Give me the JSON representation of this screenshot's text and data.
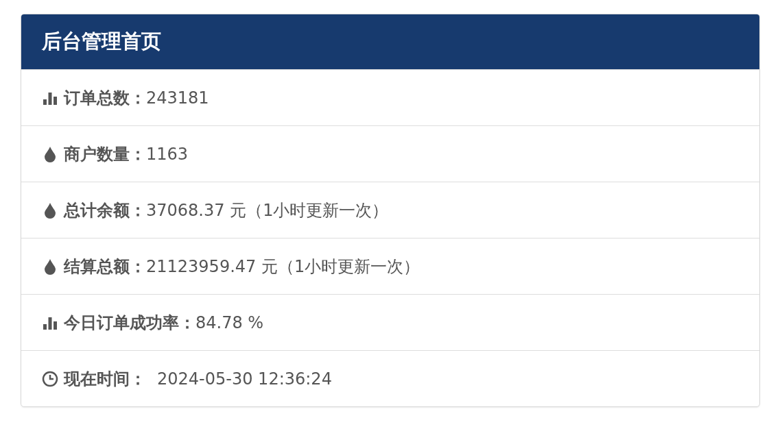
{
  "panel": {
    "title": "后台管理首页"
  },
  "rows": [
    {
      "kind": "chart",
      "label": "订单总数：",
      "value": "243181"
    },
    {
      "kind": "drop",
      "label": "商户数量：",
      "value": "1163"
    },
    {
      "kind": "drop",
      "label": "总计余额：",
      "value": "37068.37 元（1小时更新一次）"
    },
    {
      "kind": "drop",
      "label": "结算总额：",
      "value": "21123959.47 元（1小时更新一次）"
    },
    {
      "kind": "chart",
      "label": "今日订单成功率：",
      "value": "84.78 %"
    },
    {
      "kind": "clock",
      "label": "现在时间：",
      "value": "2024-05-30 12:36:24"
    }
  ]
}
